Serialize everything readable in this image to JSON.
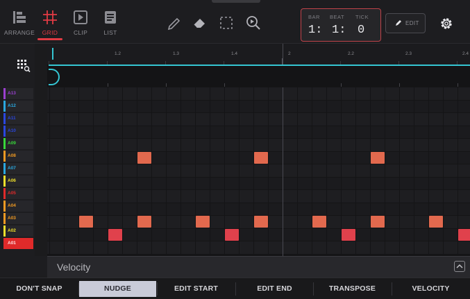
{
  "modes": [
    {
      "label": "ARRANGE",
      "icon": "arrange-icon",
      "active": false
    },
    {
      "label": "GRID",
      "icon": "grid-icon",
      "active": true
    },
    {
      "label": "CLIP",
      "icon": "clip-icon",
      "active": false
    },
    {
      "label": "LIST",
      "icon": "list-icon",
      "active": false
    }
  ],
  "tools": [
    "pencil-icon",
    "eraser-icon",
    "select-icon",
    "zoom-icon"
  ],
  "counter": {
    "bar_label": "BAR",
    "beat_label": "BEAT",
    "tick_label": "TICK",
    "bar": "1:",
    "beat": "1:",
    "tick": "0"
  },
  "edit_button": "EDIT",
  "ruler": [
    "1.2",
    "1.3",
    "1.4",
    "2",
    "2.2",
    "2.3",
    "2.4"
  ],
  "pads": [
    {
      "label": "A13",
      "color": "#9b3fd0"
    },
    {
      "label": "A12",
      "color": "#2aa8e0"
    },
    {
      "label": "A11",
      "color": "#2a46e0"
    },
    {
      "label": "A10",
      "color": "#2a46e0"
    },
    {
      "label": "A09",
      "color": "#39d83a"
    },
    {
      "label": "A08",
      "color": "#f09a22"
    },
    {
      "label": "A07",
      "color": "#2aa8e0"
    },
    {
      "label": "A06",
      "color": "#f0e02a"
    },
    {
      "label": "A05",
      "color": "#e02a2a"
    },
    {
      "label": "A04",
      "color": "#f09a22"
    },
    {
      "label": "A03",
      "color": "#f09a22"
    },
    {
      "label": "A02",
      "color": "#f0e02a"
    },
    {
      "label": "A01",
      "color": "#e02a2a",
      "selected": true
    }
  ],
  "velocity_label": "Velocity",
  "bottom_buttons": [
    {
      "label": "DON'T SNAP",
      "selected": false
    },
    {
      "label": "NUDGE",
      "selected": true
    },
    {
      "label": "EDIT START",
      "selected": false
    },
    {
      "label": "EDIT END",
      "selected": false
    },
    {
      "label": "TRANSPOSE",
      "selected": false
    },
    {
      "label": "VELOCITY",
      "selected": false
    }
  ],
  "accent_color": "#e23b44",
  "loop_color": "#35c6d3"
}
